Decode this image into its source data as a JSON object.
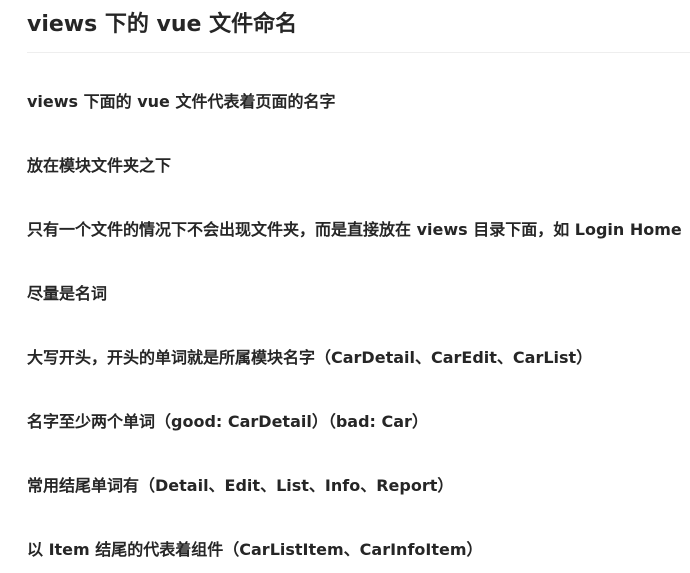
{
  "heading": "views 下的 vue 文件命名",
  "items": [
    "views 下面的 vue 文件代表着页面的名字",
    "放在模块文件夹之下",
    "只有一个文件的情况下不会出现文件夹，而是直接放在 views 目录下面，如 Login Home",
    "尽量是名词",
    "大写开头，开头的单词就是所属模块名字（CarDetail、CarEdit、CarList）",
    "名字至少两个单词（good: CarDetail）（bad: Car）",
    "常用结尾单词有（Detail、Edit、List、Info、Report）",
    "以 Item 结尾的代表着组件（CarListItem、CarInfoItem）"
  ]
}
